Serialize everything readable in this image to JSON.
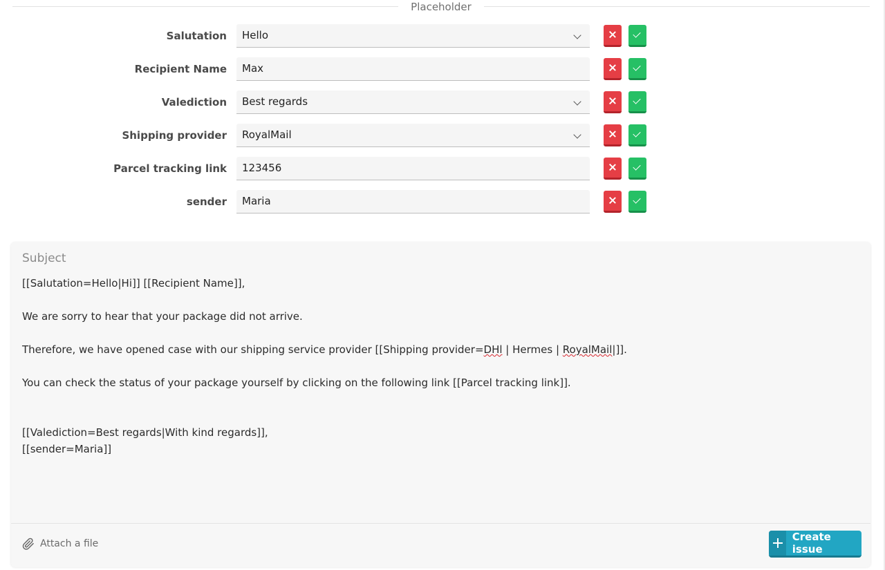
{
  "placeholder_section": {
    "title": "Placeholder"
  },
  "fields": [
    {
      "label": "Salutation",
      "value": "Hello",
      "type": "select"
    },
    {
      "label": "Recipient Name",
      "value": "Max",
      "type": "text"
    },
    {
      "label": "Valediction",
      "value": "Best regards",
      "type": "select"
    },
    {
      "label": "Shipping provider",
      "value": "RoyalMail",
      "type": "select"
    },
    {
      "label": "Parcel tracking link",
      "value": "123456",
      "type": "text"
    },
    {
      "label": "sender",
      "value": "Maria",
      "type": "text"
    }
  ],
  "editor": {
    "subject_placeholder": "Subject",
    "line1": "[[Salutation=Hello|Hi]] [[Recipient Name]],",
    "line2": "We are sorry to hear that your package did not arrive.",
    "line3_a": "Therefore, we have opened case with our shipping service provider [[Shipping provider=",
    "line3_dhl": "DHl",
    "line3_b": " | Hermes | ",
    "line3_royal": "RoyalMail",
    "line3_c": "|]].",
    "line4": "You can check the status of your package yourself by clicking on the following link [[Parcel tracking link]].",
    "line5": "[[Valediction=Best regards|With kind regards]],",
    "line6": "[[sender=Maria]]"
  },
  "footer": {
    "attach_label": "Attach a file",
    "create_label": "Create issue"
  },
  "icons": {
    "remove": "x-icon",
    "confirm": "check-icon",
    "attach": "paperclip-icon",
    "create": "plus-icon",
    "dropdown": "chevron-down-icon"
  },
  "colors": {
    "remove_button": "#e53e45",
    "confirm_button": "#26c065",
    "create_button": "#22a6c3"
  }
}
